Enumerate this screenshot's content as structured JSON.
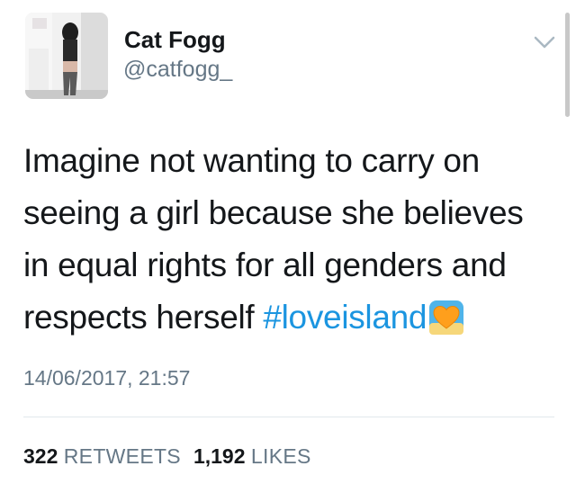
{
  "tweet": {
    "author": {
      "display_name": "Cat Fogg",
      "handle": "@catfogg_"
    },
    "text_before_hashtag": "Imagine not wanting to carry on seeing a girl because she believes in equal rights for all genders and respects herself ",
    "hashtag": "#loveisland",
    "hashtag_emoji": "heart-emoji",
    "timestamp": "14/06/2017, 21:57",
    "stats": {
      "retweets_count": "322",
      "retweets_label": "RETWEETS",
      "likes_count": "1,192",
      "likes_label": "LIKES"
    }
  },
  "colors": {
    "hashtag": "#1b95e0",
    "secondary_text": "#657786",
    "primary_text": "#14171a",
    "divider": "#e1e8ed"
  },
  "icons": {
    "menu": "chevron-down-icon"
  }
}
